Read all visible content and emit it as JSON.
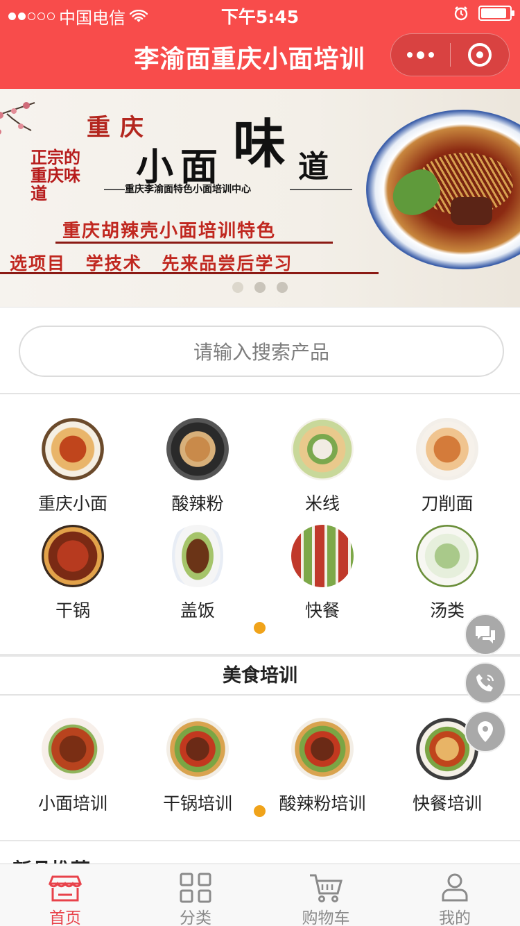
{
  "status_bar": {
    "carrier": "中国电信",
    "time": "下午5:45"
  },
  "header": {
    "title": "李渝面重庆小面培训"
  },
  "banner": {
    "small_text": "正宗的重庆味道",
    "heading_top": "重庆",
    "heading_main": "小面",
    "heading_big": "味",
    "heading_end": "道",
    "center_name": "重庆李渝面特色小面培训中心",
    "feature": "重庆胡辣壳小面培训特色",
    "slogan": "选项目 学技术 先来品尝后学习",
    "slides_total": 3,
    "slide_active": 1
  },
  "search": {
    "placeholder": "请输入搜索产品"
  },
  "categories": [
    {
      "label": "重庆小面"
    },
    {
      "label": "酸辣粉"
    },
    {
      "label": "米线"
    },
    {
      "label": "刀削面"
    },
    {
      "label": "干锅"
    },
    {
      "label": "盖饭"
    },
    {
      "label": "快餐"
    },
    {
      "label": "汤类"
    }
  ],
  "training": {
    "title": "美食培训",
    "items": [
      {
        "label": "小面培训"
      },
      {
        "label": "干锅培训"
      },
      {
        "label": "酸辣粉培训"
      },
      {
        "label": "快餐培训"
      }
    ]
  },
  "next_section": {
    "title": "新品推荐"
  },
  "floating": [
    {
      "icon": "chat-icon"
    },
    {
      "icon": "phone-icon"
    },
    {
      "icon": "location-icon"
    }
  ],
  "tabs": [
    {
      "label": "首页",
      "icon": "home-icon",
      "active": true
    },
    {
      "label": "分类",
      "icon": "grid-icon"
    },
    {
      "label": "购物车",
      "icon": "cart-icon"
    },
    {
      "label": "我的",
      "icon": "user-icon"
    }
  ],
  "colors": {
    "brand": "#f84c4b",
    "accent_dot": "#f0a31a",
    "tab_active": "#e8424a",
    "tab_inactive": "#8a8a8a"
  }
}
